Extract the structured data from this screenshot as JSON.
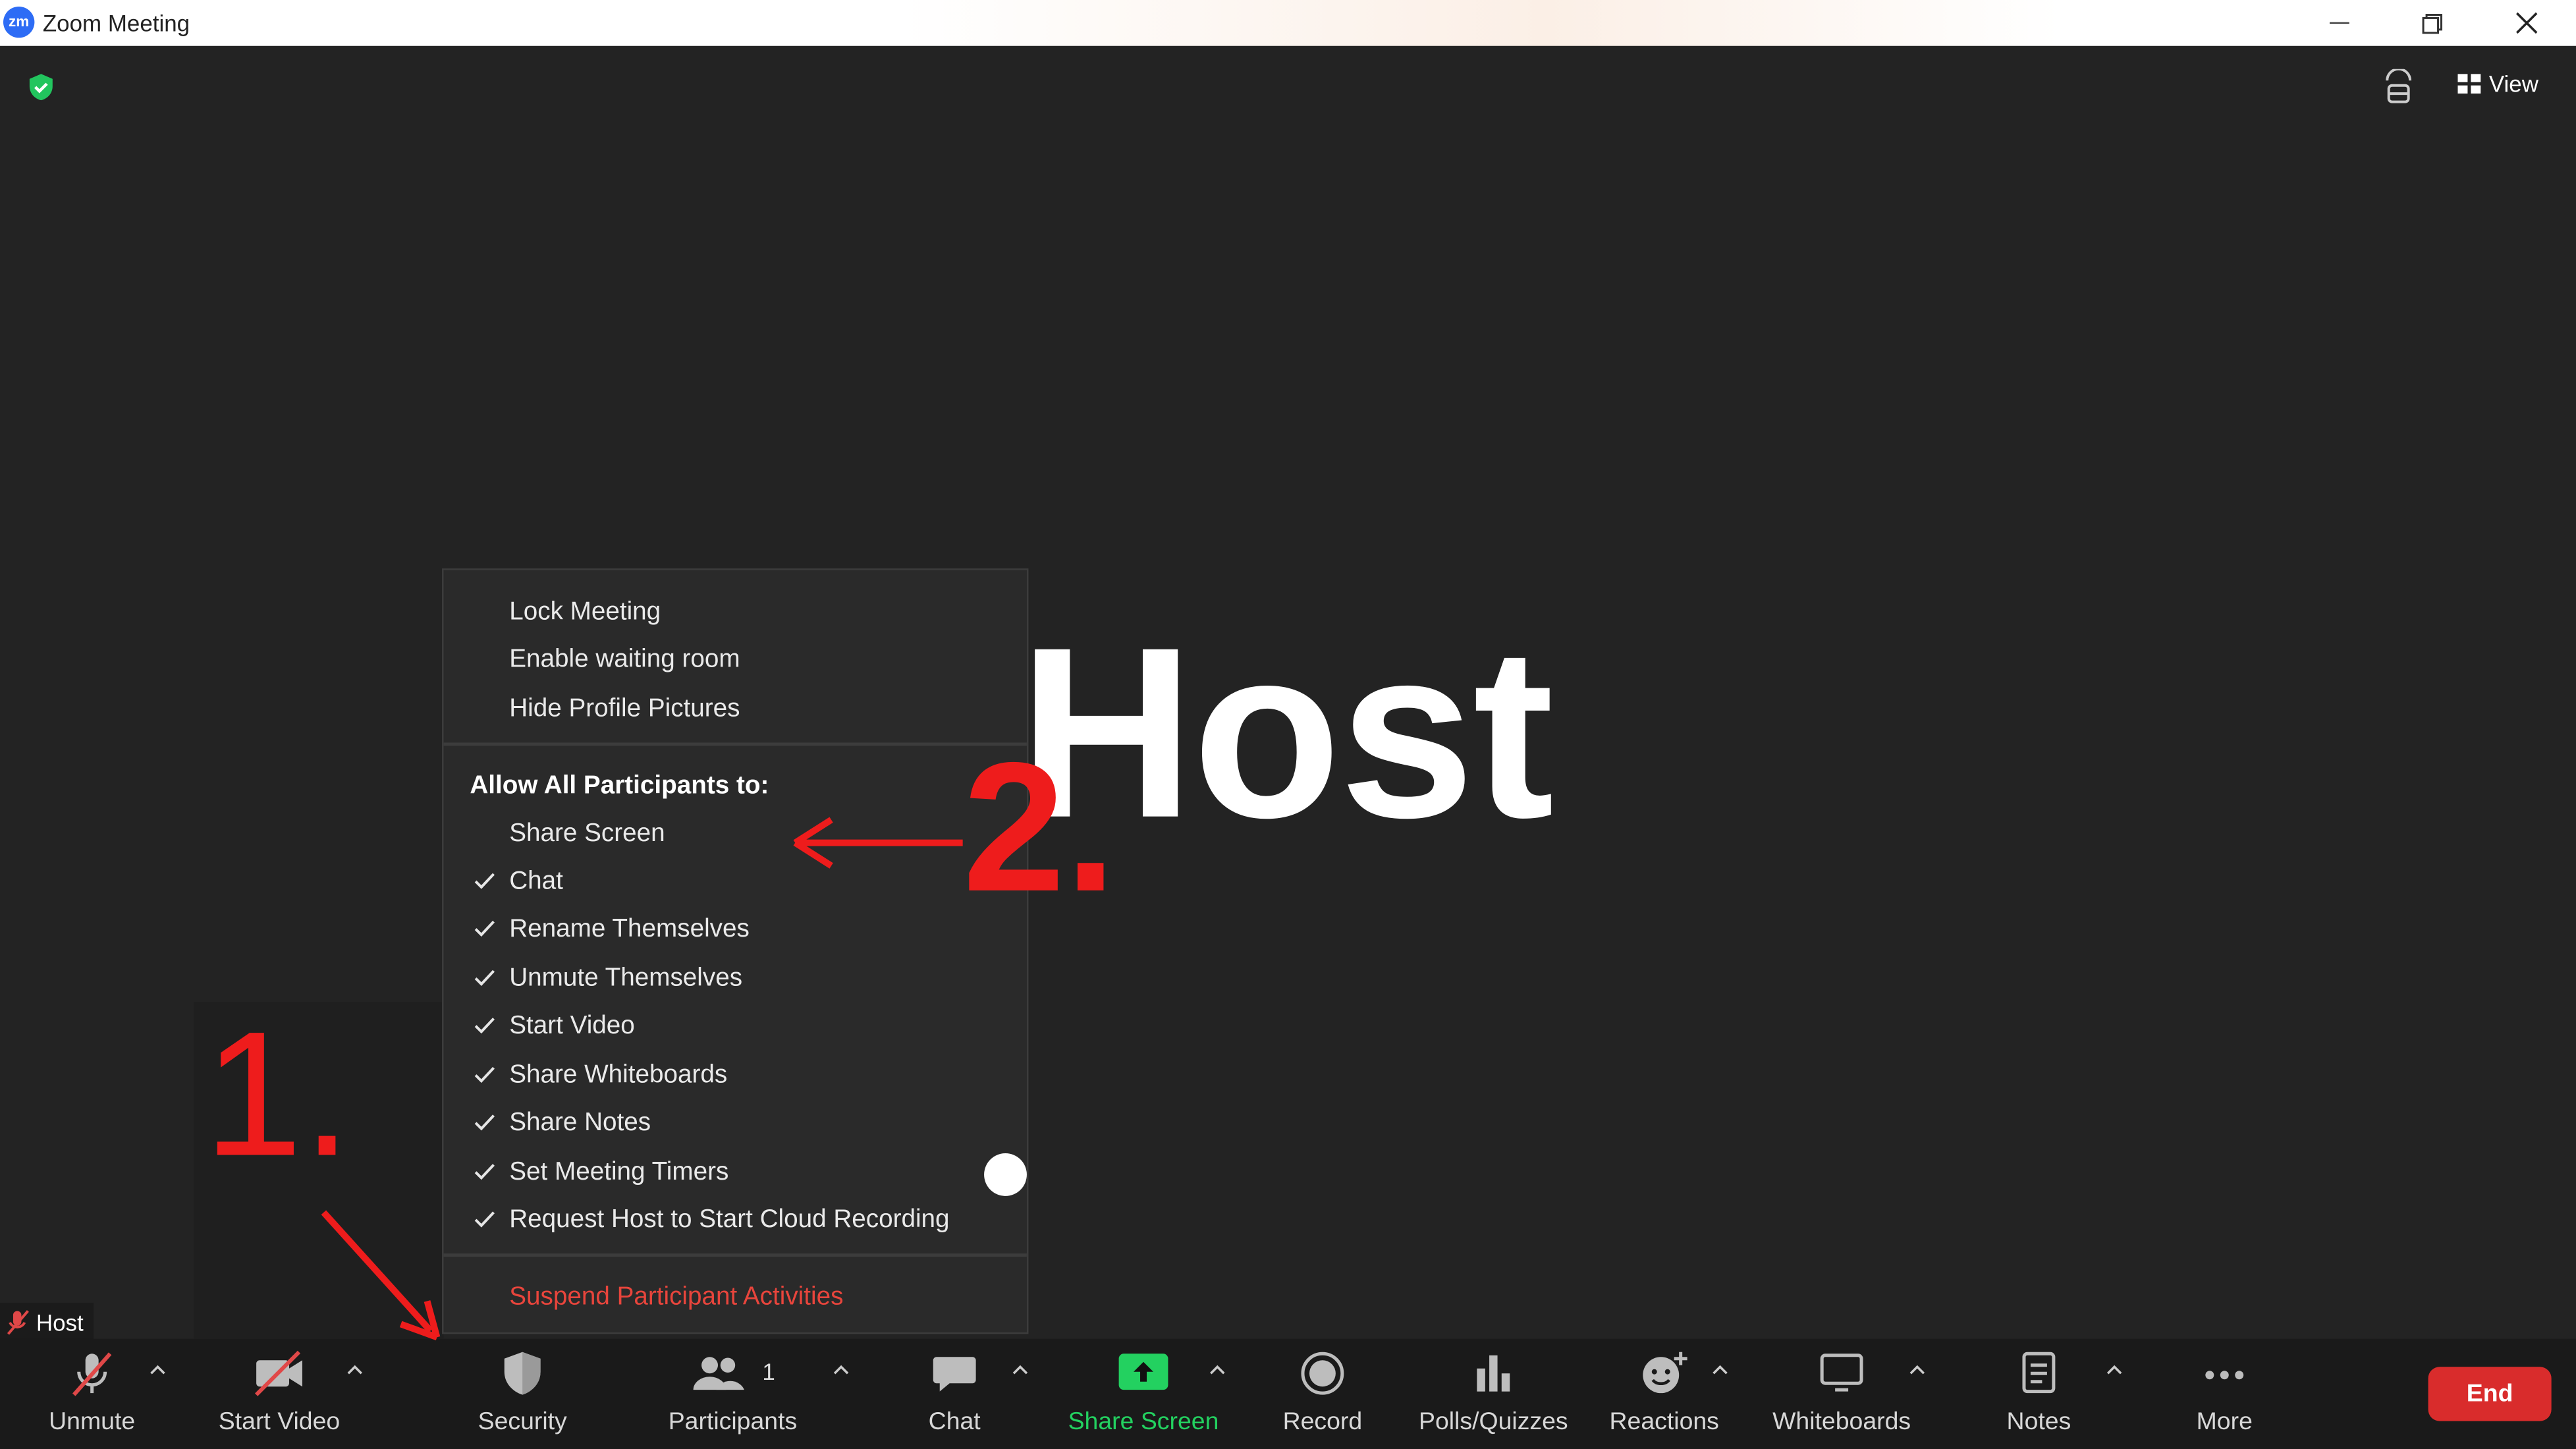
{
  "window": {
    "logo_text": "zm",
    "title": "Zoom Meeting"
  },
  "header": {
    "view_label": "View"
  },
  "video": {
    "participant_name": "Host",
    "name_tag": "Host"
  },
  "security_menu": {
    "top_items": [
      "Lock Meeting",
      "Enable waiting room",
      "Hide Profile Pictures"
    ],
    "allow_heading": "Allow All Participants to:",
    "allow_items": [
      {
        "label": "Share Screen",
        "checked": false
      },
      {
        "label": "Chat",
        "checked": true
      },
      {
        "label": "Rename Themselves",
        "checked": true
      },
      {
        "label": "Unmute Themselves",
        "checked": true
      },
      {
        "label": "Start Video",
        "checked": true
      },
      {
        "label": "Share Whiteboards",
        "checked": true
      },
      {
        "label": "Share Notes",
        "checked": true
      },
      {
        "label": "Set Meeting Timers",
        "checked": true
      },
      {
        "label": "Request Host to Start Cloud Recording",
        "checked": true
      }
    ],
    "suspend_label": "Suspend Participant Activities",
    "suspend_color": "#e8453c"
  },
  "toolbar": {
    "unmute": "Unmute",
    "start_video": "Start Video",
    "security": "Security",
    "participants": "Participants",
    "participants_count": "1",
    "chat": "Chat",
    "share_screen": "Share Screen",
    "record": "Record",
    "polls": "Polls/Quizzes",
    "reactions": "Reactions",
    "whiteboards": "Whiteboards",
    "notes": "Notes",
    "more": "More",
    "end": "End",
    "share_color": "#23d160",
    "end_color": "#d92c2c"
  },
  "annotations": {
    "step1": "1.",
    "step2": "2.",
    "color": "#ee1c1c"
  }
}
